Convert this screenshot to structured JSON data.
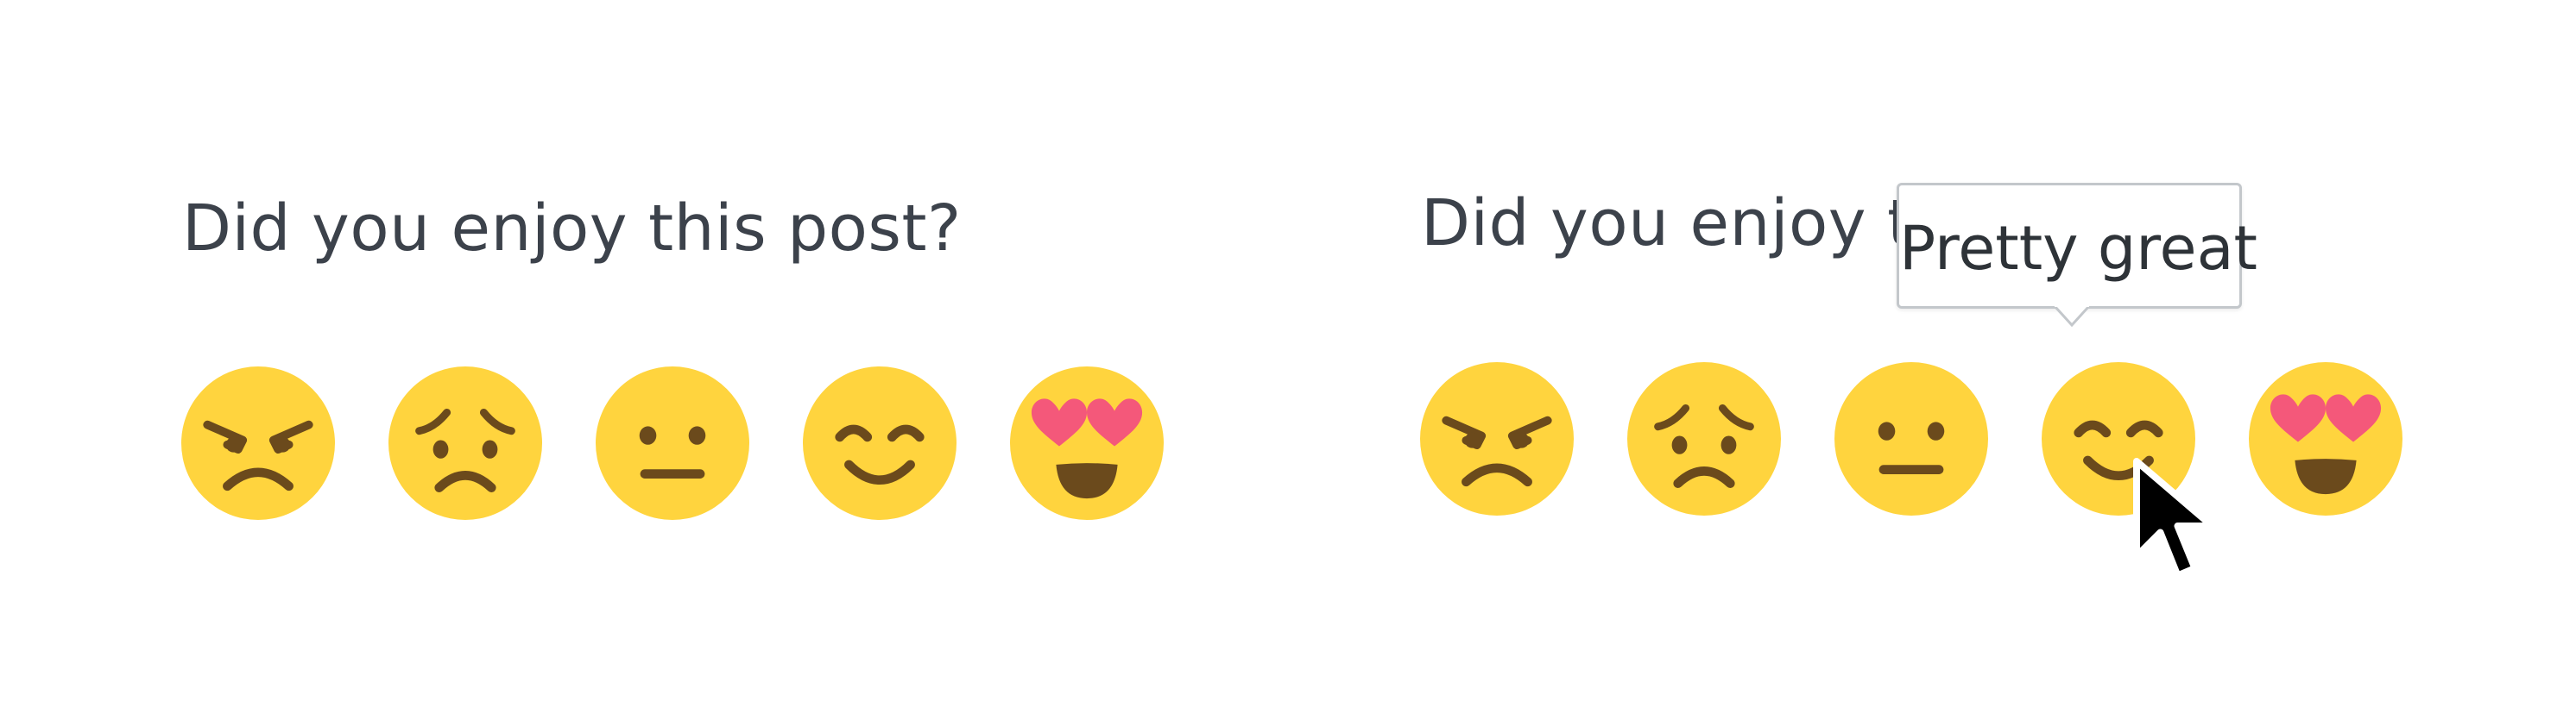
{
  "left_panel": {
    "question": "Did you enjoy this post?",
    "ratings": [
      {
        "icon": "angry-face-icon"
      },
      {
        "icon": "worried-face-icon"
      },
      {
        "icon": "neutral-face-icon"
      },
      {
        "icon": "smiling-face-icon"
      },
      {
        "icon": "heart-eyes-face-icon"
      }
    ]
  },
  "right_panel": {
    "question": "Did you enjoy this post?",
    "hovered_rating_index": 3,
    "tooltip": "Pretty great"
  },
  "colors": {
    "emoji_face": "#ffd43e",
    "emoji_feature": "#6b4a1c",
    "heart": "#f4587a",
    "question_text": "#3c424b",
    "tooltip_border": "#c3c7cb"
  }
}
